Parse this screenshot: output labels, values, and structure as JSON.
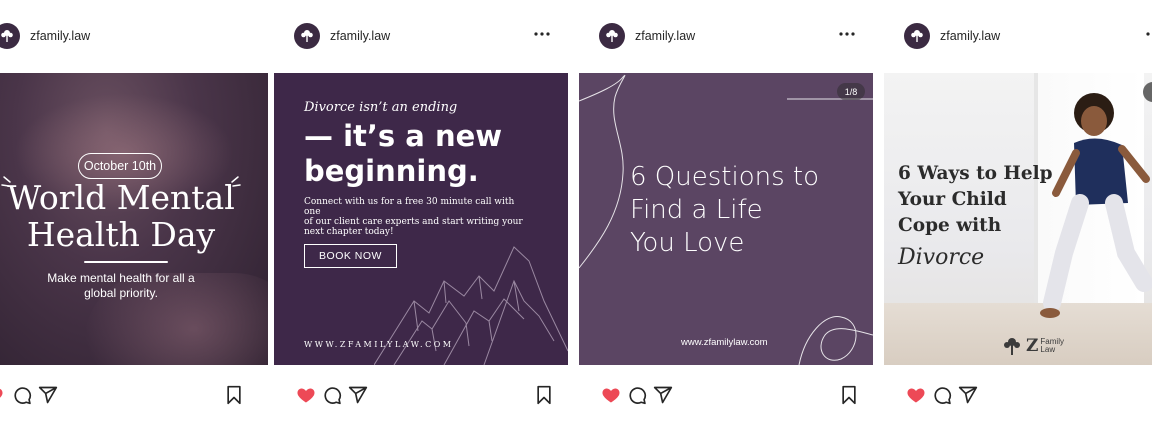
{
  "posts": [
    {
      "username": "zfamily.law",
      "image": {
        "date_pill": "October 10th",
        "title_line1": "World Mental",
        "title_line2": "Health Day",
        "subtitle_line1": "Make mental health for all a",
        "subtitle_line2": "global priority."
      },
      "liked": true
    },
    {
      "username": "zfamily.law",
      "image": {
        "intro": "Divorce isn’t an ending",
        "headline_line1": "— it’s a new",
        "headline_line2": "beginning.",
        "body_line1": "Connect with us for a free 30 minute call with one",
        "body_line2": "of our client care experts and start writing your",
        "body_line3": "next chapter today!",
        "button": "BOOK NOW",
        "website": "WWW.ZFAMILYLAW.COM"
      },
      "liked": true
    },
    {
      "username": "zfamily.law",
      "image": {
        "counter": "1/8",
        "title_line1": "6 Questions to",
        "title_line2": "Find a Life",
        "title_line3": "You Love",
        "website": "www.zfamilylaw.com"
      },
      "liked": true
    },
    {
      "username": "zfamily.law",
      "image": {
        "title_line1": "6 Ways to Help",
        "title_line2": "Your Child",
        "title_line3": "Cope with",
        "script": "Divorce",
        "logo_letter": "Z",
        "logo_line1": "Family",
        "logo_line2": "Law"
      },
      "liked": true
    }
  ],
  "icons": {
    "avatar": "tree-logo-icon",
    "more": "more-horizontal-icon",
    "like": "heart-icon",
    "comment": "comment-icon",
    "share": "paper-plane-icon",
    "save": "bookmark-icon"
  },
  "colors": {
    "like": "#ed4956",
    "brand_purple": "#3e2849",
    "card_purple": "#5b4563"
  }
}
